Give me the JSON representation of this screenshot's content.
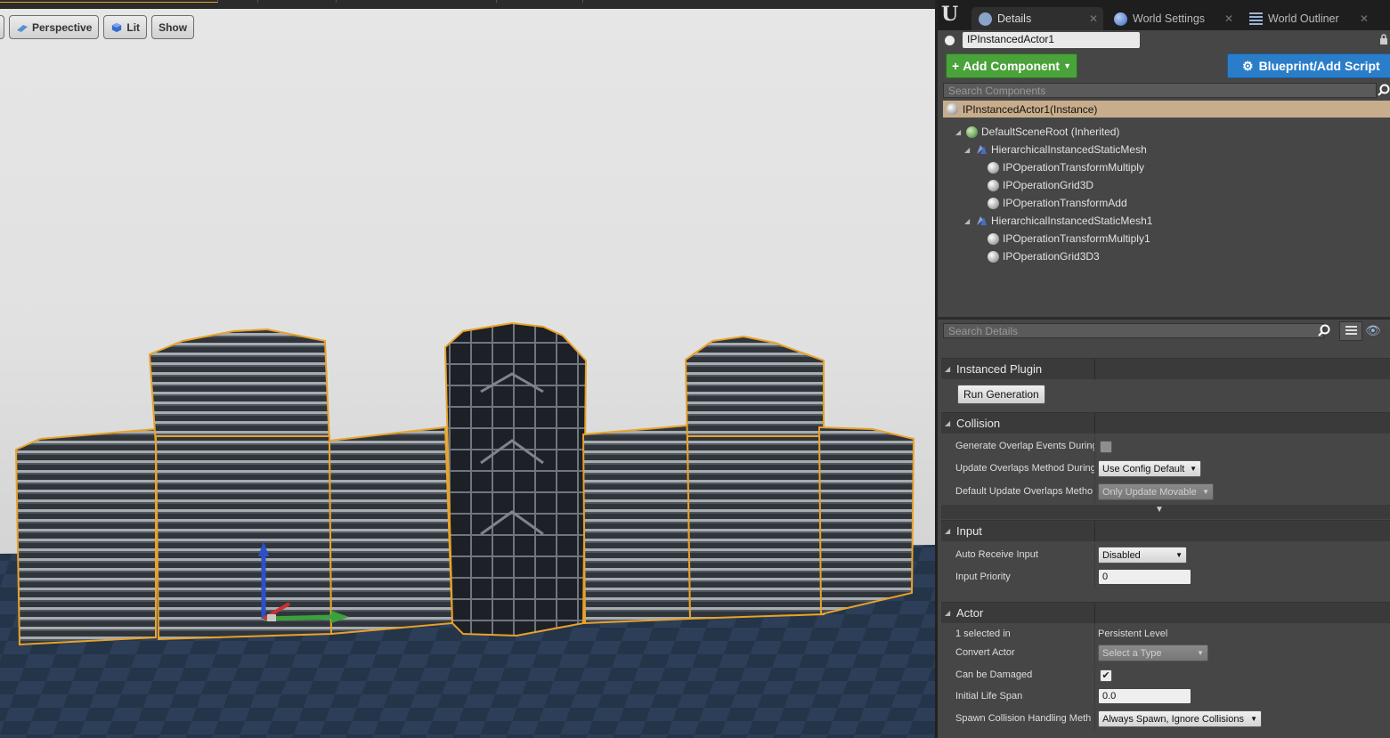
{
  "viewport": {
    "toolbar": {
      "perspective_label": "Perspective",
      "lit_label": "Lit",
      "show_label": "Show"
    }
  },
  "tabs": [
    {
      "label": "Details",
      "icon": "details-icon"
    },
    {
      "label": "World Settings",
      "icon": "globe-icon"
    },
    {
      "label": "World Outliner",
      "icon": "outliner-icon"
    }
  ],
  "actor": {
    "name": "IPInstancedActor1"
  },
  "buttons": {
    "add_component": "Add Component",
    "blueprint": "Blueprint/Add Script"
  },
  "components": {
    "search_placeholder": "Search Components",
    "selected": "IPInstancedActor1(Instance)",
    "tree": [
      {
        "label": "DefaultSceneRoot (Inherited)",
        "level": 0,
        "icon": "scene-root-icon",
        "arrow": true
      },
      {
        "label": "HierarchicalInstancedStaticMesh",
        "level": 1,
        "icon": "hism-icon",
        "arrow": true
      },
      {
        "label": "IPOperationTransformMultiply",
        "level": 2,
        "icon": "sphere-icon",
        "arrow": false
      },
      {
        "label": "IPOperationGrid3D",
        "level": 2,
        "icon": "sphere-icon",
        "arrow": false
      },
      {
        "label": "IPOperationTransformAdd",
        "level": 2,
        "icon": "sphere-icon",
        "arrow": false
      },
      {
        "label": "HierarchicalInstancedStaticMesh1",
        "level": 1,
        "icon": "hism-icon",
        "arrow": true
      },
      {
        "label": "IPOperationTransformMultiply1",
        "level": 2,
        "icon": "sphere-icon",
        "arrow": false
      },
      {
        "label": "IPOperationGrid3D3",
        "level": 2,
        "icon": "sphere-icon",
        "arrow": false
      }
    ]
  },
  "details": {
    "search_placeholder": "Search Details",
    "sections": {
      "instanced_plugin": {
        "title": "Instanced Plugin",
        "run_generation": "Run Generation"
      },
      "collision": {
        "title": "Collision",
        "generate_overlap_label": "Generate Overlap Events During",
        "generate_overlap_checked": false,
        "update_overlaps_label": "Update Overlaps Method During",
        "update_overlaps_value": "Use Config Default",
        "default_update_label": "Default Update Overlaps Metho",
        "default_update_value": "Only Update Movable"
      },
      "input": {
        "title": "Input",
        "auto_receive_label": "Auto Receive Input",
        "auto_receive_value": "Disabled",
        "input_priority_label": "Input Priority",
        "input_priority_value": "0"
      },
      "actor": {
        "title": "Actor",
        "selected_in_label": "1 selected in",
        "selected_in_value": "Persistent Level",
        "convert_actor_label": "Convert Actor",
        "convert_actor_value": "Select a Type",
        "can_be_damaged_label": "Can be Damaged",
        "can_be_damaged_checked": true,
        "initial_life_span_label": "Initial Life Span",
        "initial_life_span_value": "0.0",
        "spawn_collision_label": "Spawn Collision Handling Meth",
        "spawn_collision_value": "Always Spawn, Ignore Collisions"
      }
    }
  },
  "colors": {
    "add_component": "#4aa23a",
    "blueprint": "#2a7dc8",
    "selected_component": "#c8ad8c",
    "selection_outline": "#e8a22a"
  }
}
